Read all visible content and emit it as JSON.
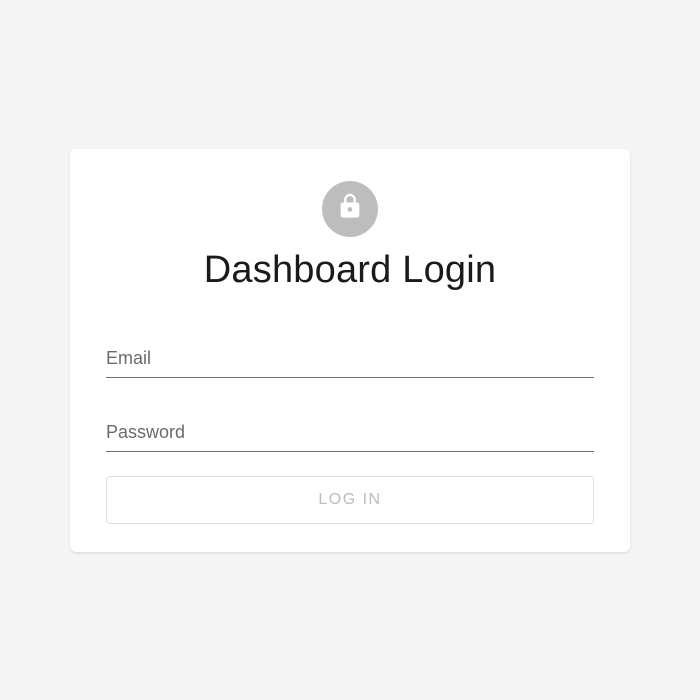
{
  "login": {
    "title": "Dashboard Login",
    "email": {
      "placeholder": "Email",
      "value": ""
    },
    "password": {
      "placeholder": "Password",
      "value": ""
    },
    "submit_label": "Log In"
  },
  "icons": {
    "lock": "lock-icon"
  },
  "colors": {
    "background": "#f5f5f5",
    "card": "#ffffff",
    "avatar_bg": "#bdbdbd",
    "title_text": "#1a1a1a",
    "placeholder": "#6b6b6b",
    "underline": "#6f6f6f",
    "btn_border": "#e0e0e0",
    "btn_text": "#bdbdbd"
  }
}
